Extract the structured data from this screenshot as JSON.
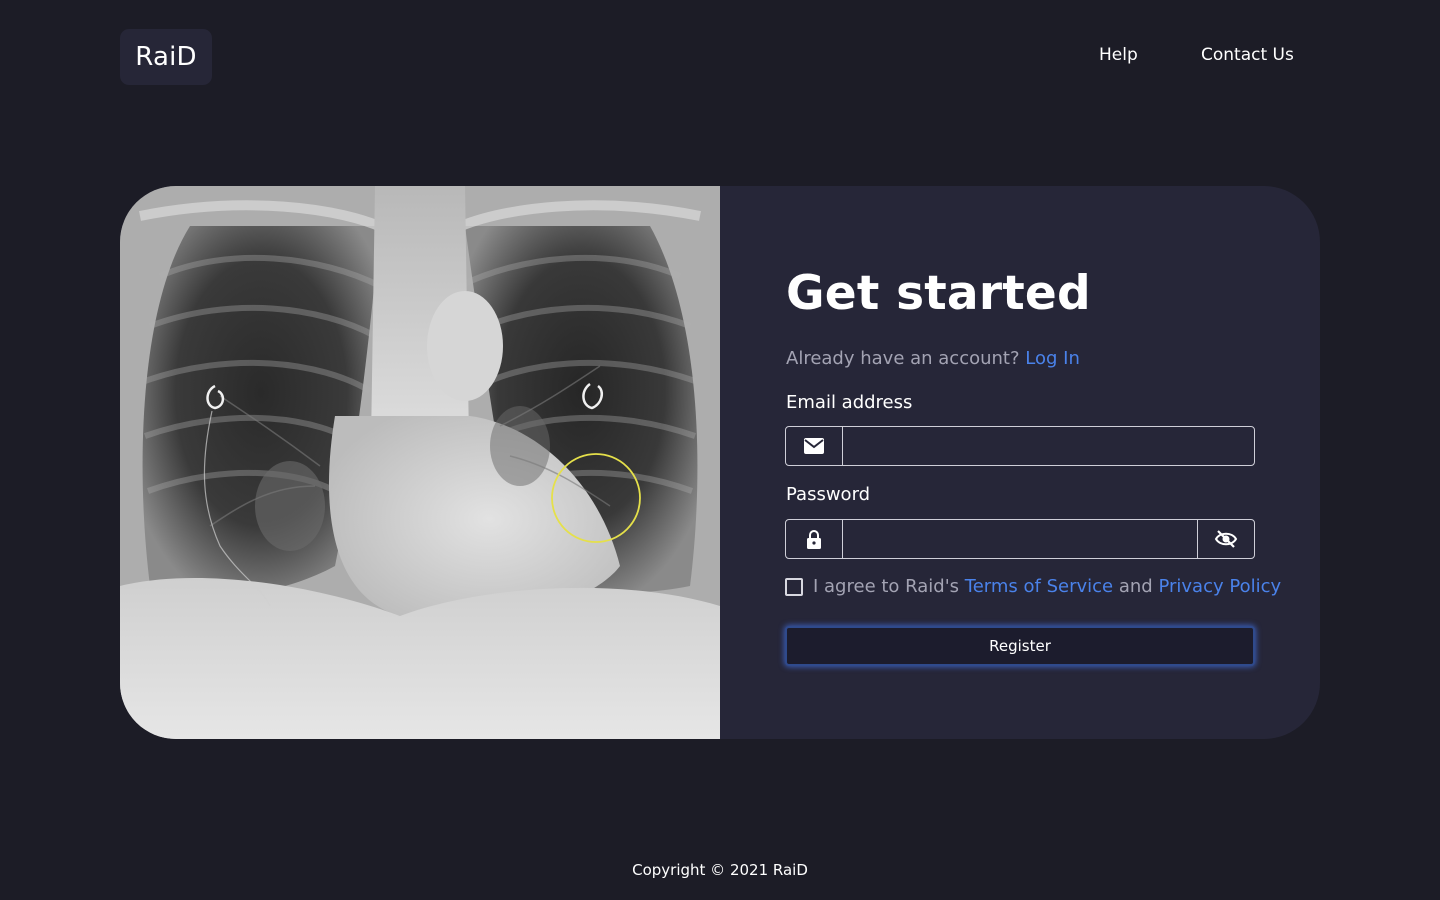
{
  "brand": {
    "logo_text": "RaiD"
  },
  "nav": {
    "help_label": "Help",
    "contact_label": "Contact Us"
  },
  "hero_image": {
    "kind": "chest x-ray",
    "annotation_color": "#e5e04a"
  },
  "form": {
    "heading": "Get started",
    "login_prompt": "Already have an account?",
    "login_link": "Log In",
    "email_label": "Email address",
    "email_value": "",
    "email_icon": "envelope-icon",
    "password_label": "Password",
    "password_value": "",
    "password_icon": "lock-icon",
    "visibility_icon": "eye-slash-icon",
    "agree_prefix": "I agree to Raid's",
    "terms_link": "Terms of Service",
    "agree_and": "and",
    "privacy_link": "Privacy Policy",
    "agree_checked": false,
    "register_label": "Register"
  },
  "footer": {
    "copyright": "Copyright © 2021 RaiD"
  },
  "colors": {
    "page_bg": "#1c1c26",
    "card_bg": "#262638",
    "link": "#4a82ea",
    "muted_text": "#a3a3b3",
    "button_glow": "#426edc"
  }
}
